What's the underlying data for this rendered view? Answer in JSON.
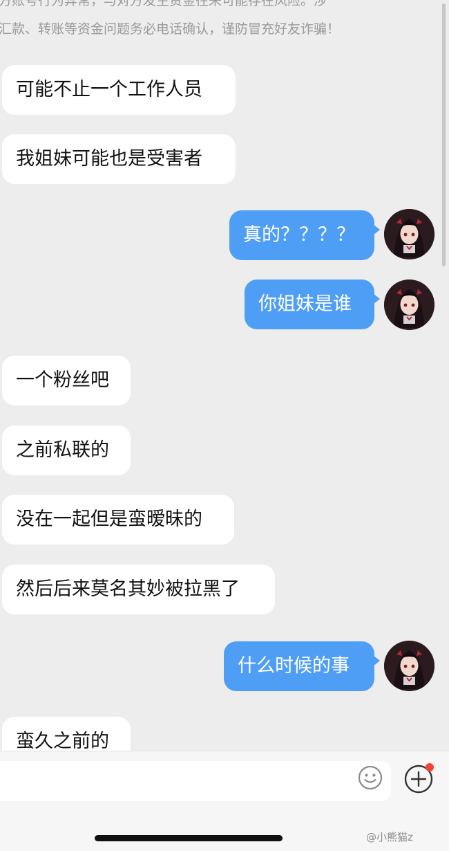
{
  "system_notice": {
    "line1": "方账号行为异常，与对方发生资金往来可能存在风险。涉",
    "line2": "汇款、转账等资金问题务必电话确认，谨防冒充好友诈骗！"
  },
  "messages": [
    {
      "side": "in",
      "text": "可能不止一个工作人员"
    },
    {
      "side": "in",
      "text": "我姐妹可能也是受害者"
    },
    {
      "side": "out",
      "text": "真的？？？？"
    },
    {
      "side": "out",
      "text": "你姐妹是谁"
    },
    {
      "side": "in",
      "text": "一个粉丝吧"
    },
    {
      "side": "in",
      "text": "之前私联的"
    },
    {
      "side": "in",
      "text": "没在一起但是蛮暧昧的"
    },
    {
      "side": "in",
      "text": "然后后来莫名其妙被拉黑了"
    },
    {
      "side": "out",
      "text": "什么时候的事"
    },
    {
      "side": "in",
      "text": "蛮久之前的"
    }
  ],
  "input": {
    "value": "",
    "placeholder": ""
  },
  "icons": {
    "emoji": "smiley-icon",
    "plus": "plus-circle-icon",
    "badge_color": "#f44336"
  },
  "colors": {
    "outgoing_bubble": "#4f9ef5",
    "incoming_bubble": "#ffffff",
    "background": "#ededed"
  },
  "watermark": "@小熊猫z"
}
